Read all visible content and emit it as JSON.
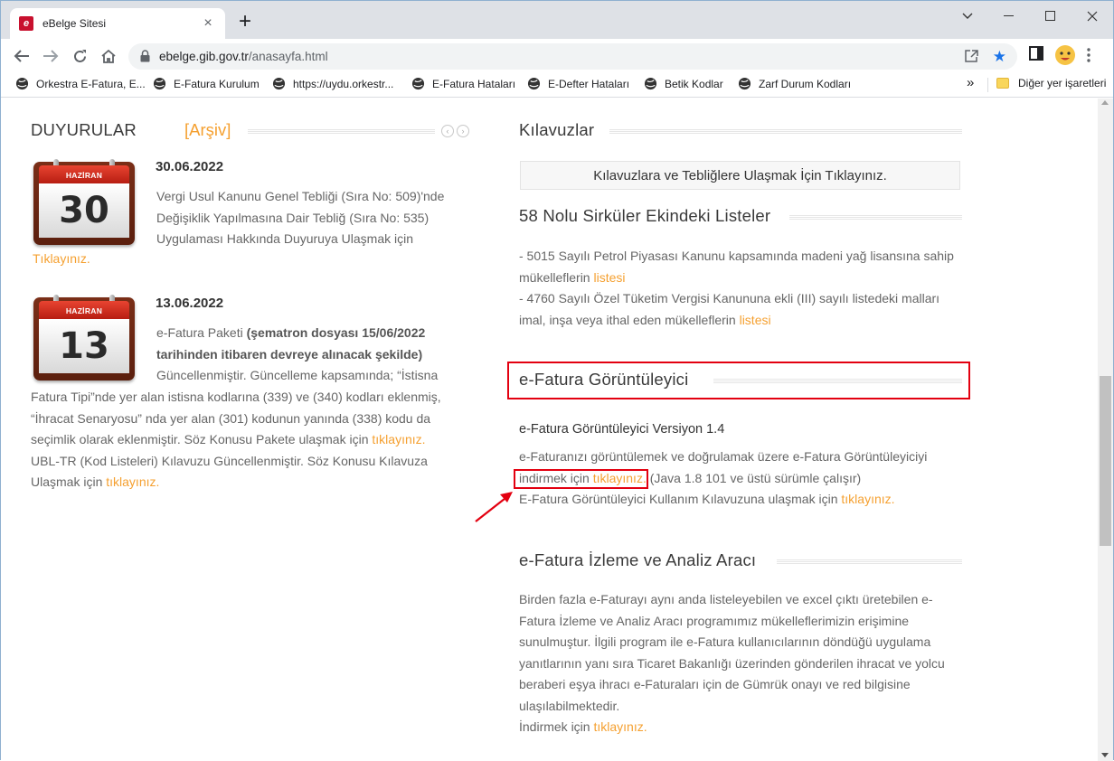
{
  "browser": {
    "tab_title": "eBelge Sitesi",
    "url_domain": "ebelge.gib.gov.tr",
    "url_path": "/anasayfa.html",
    "bookmarks": [
      "Orkestra E-Fatura, E...",
      "E-Fatura Kurulum",
      "https://uydu.orkestr...",
      "E-Fatura Hataları",
      "E-Defter Hataları",
      "Betik Kodlar",
      "Zarf Durum Kodları"
    ],
    "other_bookmarks": "Diğer yer işaretleri",
    "more": "»"
  },
  "left": {
    "title": "DUYURULAR",
    "archive": "[Arşiv]",
    "news": [
      {
        "month": "HAZİRAN",
        "day": "30",
        "date": "30.06.2022",
        "line1": "Vergi Usul Kanunu Genel Tebliği (Sıra No: 509)'nde",
        "line2": "Değişiklik Yapılmasına Dair Tebliğ (Sıra No: 535)",
        "line3": "Uygulaması Hakkında Duyuruya Ulaşmak için",
        "link": "Tıklayınız."
      },
      {
        "month": "HAZİRAN",
        "day": "13",
        "date": "13.06.2022",
        "l1a": "e-Fatura Paketi ",
        "l1b": "(şematron dosyası 15/06/2022",
        "l2": "tarihinden itibaren devreye alınacak şekilde)",
        "l3": "Güncellenmiştir. Güncelleme kapsamında; “İstisna",
        "l4": "Fatura Tipi”nde yer alan istisna kodlarına (339) ve (340) kodları eklenmiş,",
        "l5": "“İhracat Senaryosu” nda yer alan (301) kodunun yanında (338) kodu da",
        "l6": "seçimlik olarak eklenmiştir. Söz Konusu Pakete ulaşmak için ",
        "l6link": "tıklayınız.",
        "l7": "UBL-TR (Kod Listeleri) Kılavuzu Güncellenmiştir. Söz Konusu Kılavuza",
        "l8": "Ulaşmak için ",
        "l8link": "tıklayınız."
      }
    ]
  },
  "right": {
    "guides_title": "Kılavuzlar",
    "guides_button": "Kılavuzlara ve Tebliğlere Ulaşmak İçin Tıklayınız.",
    "circular_title": "58 Nolu Sirküler Ekindeki Listeler",
    "c1": "- 5015 Sayılı Petrol Piyasası Kanunu kapsamında madeni yağ lisansına sahip",
    "c2": "mükelleflerin ",
    "c2link": "listesi",
    "c3": "- 4760 Sayılı Özel Tüketim Vergisi Kanununa ekli (III) sayılı listedeki malları",
    "c4": "imal, inşa veya ithal eden mükelleflerin ",
    "c4link": "listesi",
    "viewer_title": "e-Fatura Görüntüleyici",
    "viewer_version": "e-Fatura Görüntüleyici Versiyon 1.4",
    "v1": "e-Faturanızı görüntülemek ve doğrulamak üzere e-Fatura Görüntüleyiciyi",
    "v2a": "indirmek için ",
    "v2link": "tıklayınız.",
    "v2b": " (Java 1.8 101 ve üstü sürümle çalışır)",
    "v3": "E-Fatura Görüntüleyici Kullanım Kılavuzuna ulaşmak için ",
    "v3link": "tıklayınız.",
    "monitor_title": "e-Fatura İzleme ve Analiz Aracı",
    "m1": "Birden fazla e-Faturayı aynı anda listeleyebilen ve excel çıktı üretebilen e-",
    "m2": "Fatura İzleme ve Analiz Aracı programımız mükelleflerimizin erişimine",
    "m3": "sunulmuştur. İlgili program ile e-Fatura kullanıcılarının döndüğü uygulama",
    "m4": "yanıtlarının yanı sıra Ticaret Bakanlığı üzerinden gönderilen ihracat ve yolcu",
    "m5": "beraberi eşya ihracı e-Faturaları için de Gümrük onayı ve red bilgisine",
    "m6": "ulaşılabilmektedir.",
    "m7": "İndirmek için ",
    "m7link": "tıklayınız."
  },
  "colors": {
    "link": "#f5a030",
    "highlight": "#e30010",
    "accent": "#1a73e8"
  }
}
